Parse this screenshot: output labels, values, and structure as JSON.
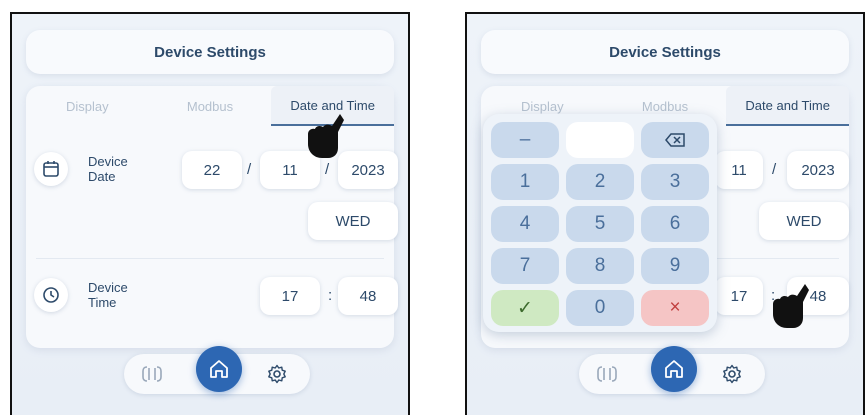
{
  "header": {
    "title": "Device Settings"
  },
  "tabs": [
    "Display",
    "Modbus",
    "Date and Time"
  ],
  "date": {
    "label": "Device Date",
    "day": "22",
    "month": "11",
    "year": "2023",
    "weekday": "WED",
    "separator": "/"
  },
  "time": {
    "label": "Device Time",
    "hour": "17",
    "minute": "48",
    "separator": ":"
  },
  "keypad": {
    "keys": [
      "–",
      "",
      "⌫",
      "1",
      "2",
      "3",
      "4",
      "5",
      "6",
      "7",
      "8",
      "9",
      "✓",
      "0",
      "×"
    ]
  },
  "icons": {
    "calendar": "calendar-icon",
    "clock": "clock-icon",
    "connection": "connection-icon",
    "home": "home-icon",
    "settings": "gear-icon",
    "hand": "hand-pointer-icon"
  },
  "colors": {
    "primary": "#2d67b3",
    "text": "#2d4a6a",
    "ok": "#cfe9c2",
    "cancel": "#f5c5c5"
  }
}
